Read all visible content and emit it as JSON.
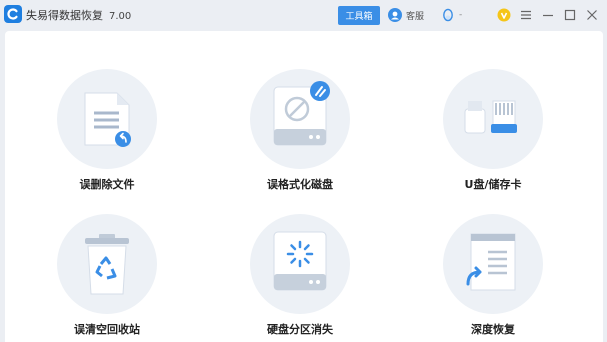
{
  "app": {
    "title": "失易得数据恢复",
    "version": "7.00",
    "toolbox_label": "工具箱",
    "support_label": "客服",
    "qq_label": "-"
  },
  "icons": {
    "logo": "app-logo-icon",
    "support": "headset-icon",
    "qq": "qq-penguin-icon",
    "vip": "vip-badge-icon",
    "menu": "menu-icon",
    "minimize": "minimize-icon",
    "maximize": "maximize-icon",
    "close": "close-icon"
  },
  "colors": {
    "accent": "#3a8ee6",
    "badge": "#f5c518",
    "icon_bg": "#edf1f6"
  },
  "modes": [
    {
      "label": "误删除文件",
      "icon": "deleted-file-icon"
    },
    {
      "label": "误格式化磁盘",
      "icon": "formatted-disk-icon"
    },
    {
      "label": "U盘/储存卡",
      "icon": "usb-card-icon"
    },
    {
      "label": "误清空回收站",
      "icon": "recycle-bin-icon"
    },
    {
      "label": "硬盘分区消失",
      "icon": "lost-partition-icon"
    },
    {
      "label": "深度恢复",
      "icon": "deep-recovery-icon"
    }
  ]
}
